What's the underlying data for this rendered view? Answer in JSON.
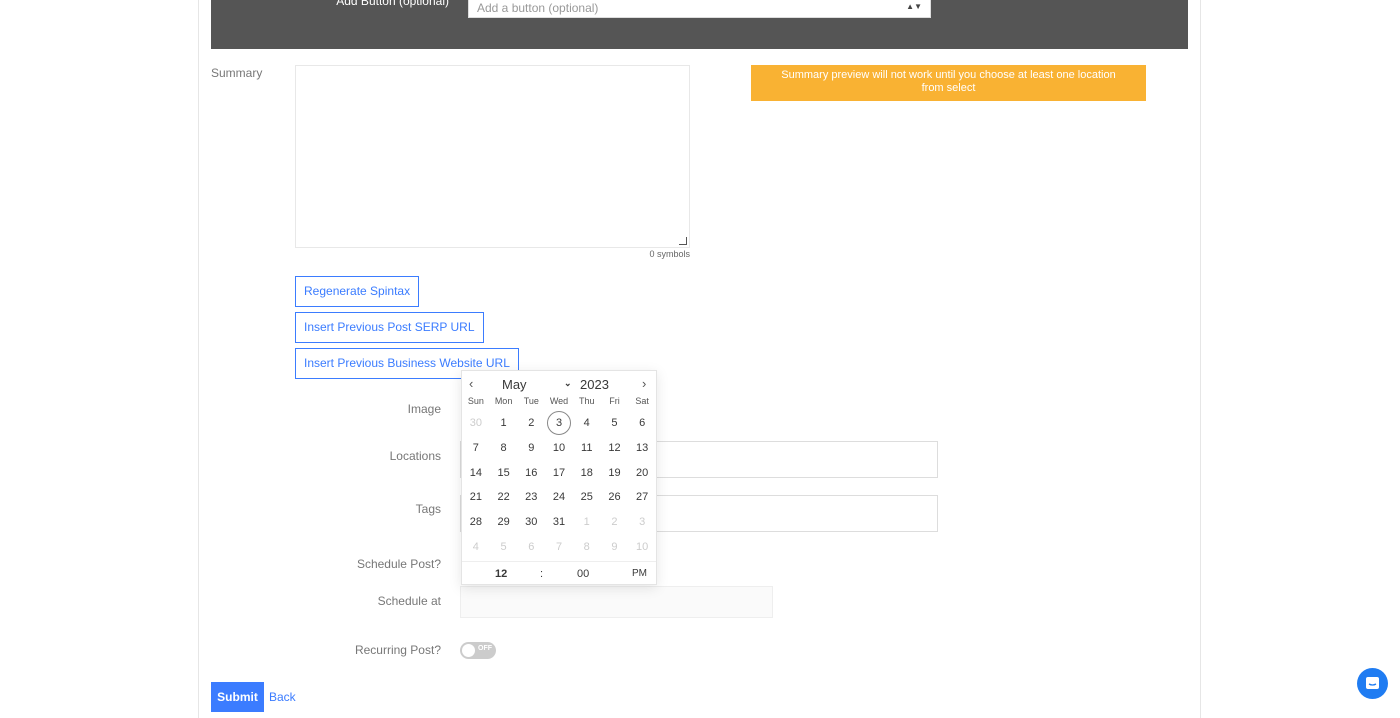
{
  "add_button": {
    "label": "Add Button (optional)",
    "placeholder": "Add a button (optional)"
  },
  "summary": {
    "label": "Summary",
    "value": "",
    "counter": "0 symbols",
    "warning": "Summary preview will not work until you choose at least one location from select"
  },
  "actions": [
    "Regenerate Spintax",
    "Insert Previous Post SERP URL",
    "Insert Previous Business Website URL"
  ],
  "fields": {
    "image": "Image",
    "locations": "Locations",
    "tags": "Tags",
    "schedule_post": "Schedule Post?",
    "schedule_at": "Schedule at",
    "recurring": "Recurring Post?"
  },
  "recurring_toggle": {
    "state": "OFF"
  },
  "calendar": {
    "month": "May",
    "year": "2023",
    "weekdays": [
      "Sun",
      "Mon",
      "Tue",
      "Wed",
      "Thu",
      "Fri",
      "Sat"
    ],
    "weeks": [
      [
        "30",
        "1",
        "2",
        "3",
        "4",
        "5",
        "6"
      ],
      [
        "7",
        "8",
        "9",
        "10",
        "11",
        "12",
        "13"
      ],
      [
        "14",
        "15",
        "16",
        "17",
        "18",
        "19",
        "20"
      ],
      [
        "21",
        "22",
        "23",
        "24",
        "25",
        "26",
        "27"
      ],
      [
        "28",
        "29",
        "30",
        "31",
        "1",
        "2",
        "3"
      ],
      [
        "4",
        "5",
        "6",
        "7",
        "8",
        "9",
        "10"
      ]
    ],
    "today": "3",
    "hour": "12",
    "minute": "00",
    "ampm": "PM",
    "separator": ":"
  },
  "buttons": {
    "submit": "Submit",
    "back": "Back"
  },
  "colors": {
    "primary": "#3b7cff",
    "warning": "#f9b233",
    "panel": "#555555"
  }
}
